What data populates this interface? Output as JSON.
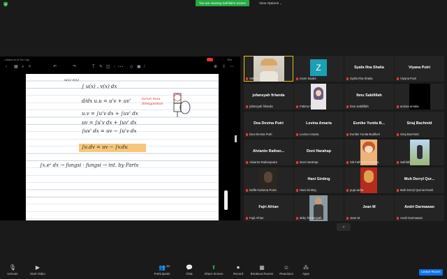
{
  "top": {
    "viewing_text": "You are viewing Safrilah's screen",
    "view_options": "View Options"
  },
  "ipad": {
    "status_left": "◂ Search 14.15 Thu 7 Apr",
    "status_right": "92%"
  },
  "note": {
    "lines": [
      "u(x) v(x)",
      "∫ u(x) . v(x) dx",
      "d/dx u.u = u'v + uv'",
      "u.v = ∫u'v dx + ∫uv' dx",
      "uv = ∫u'v dx + ∫uv' dx",
      "∫uv' dx = uv − ∫u'v dx",
      "∫u.dv = uv − ∫v.du",
      "∫x.eˣ dx  →  fungsi · fungsi  →  int. by Parts"
    ],
    "annotations": [
      "turun mau",
      "dinegasikan"
    ]
  },
  "participants": [
    {
      "big": "",
      "label": "Safrilah",
      "photo": "person",
      "active": true
    },
    {
      "big": "Z",
      "label": "zoom baa04",
      "photo": "avatar-z",
      "active": false
    },
    {
      "big": "Syafa Ifna Shalia",
      "label": "Syafa Ifna Shalia",
      "photo": "",
      "active": false
    },
    {
      "big": "Viyana Putri",
      "label": "Viyana Putri",
      "photo": "",
      "active": false
    },
    {
      "big": "jofansyah firlanda",
      "label": "jofansyah firlanda",
      "photo": "",
      "active": false
    },
    {
      "big": "",
      "label": "Fatima Nazril",
      "photo": "hijab",
      "active": false
    },
    {
      "big": "Ibnu Sabilillah",
      "label": "Ibnu Sabilillah",
      "photo": "",
      "active": false
    },
    {
      "big": "",
      "label": "annisa amalia",
      "photo": "black",
      "active": false
    },
    {
      "big": "Dea Devina Putri",
      "label": "Dea Devina Putri",
      "photo": "",
      "active": false
    },
    {
      "big": "Levina Amaria",
      "label": "Levina Amaria",
      "photo": "",
      "active": false
    },
    {
      "big": "Eunike Yunita B...",
      "label": "Eunike Yunita Budiheri",
      "photo": "",
      "active": false
    },
    {
      "big": "Siraj Bachmid",
      "label": "Siraj Bachmid",
      "photo": "",
      "active": false
    },
    {
      "big": "Alvianto Raihan...",
      "label": "Alvianto Raihanputra",
      "photo": "",
      "active": false
    },
    {
      "big": "Doni Harahap",
      "label": "Doni Harahap",
      "photo": "",
      "active": false
    },
    {
      "big": "",
      "label": "Siti Fathimah Nadhira",
      "photo": "anime",
      "active": false
    },
    {
      "big": "",
      "label": "Safrilah",
      "photo": "outdoor",
      "active": false
    },
    {
      "big": "",
      "label": "Daffa Karisma Putra",
      "photo": "dark",
      "active": false
    },
    {
      "big": "Hani Ginting",
      "label": "Hani Ginting",
      "photo": "",
      "active": false
    },
    {
      "big": "",
      "label": "puja widia",
      "photo": "red",
      "active": false
    },
    {
      "big": "Muh Derryl Qur...",
      "label": "Muh Derryl Qurnia Ramli",
      "photo": "",
      "active": false
    },
    {
      "big": "Fajri Afrian",
      "label": "Fajri Afrian",
      "photo": "",
      "active": false
    },
    {
      "big": "",
      "label": "abby firmansyah",
      "photo": "man",
      "active": false
    },
    {
      "big": "Jean M",
      "label": "Jean M",
      "photo": "",
      "active": false
    },
    {
      "big": "Andri Darmawan",
      "label": "Andri Darmawan",
      "photo": "",
      "active": false
    }
  ],
  "controls": {
    "unmute": "Unmute",
    "start_video": "Start Video",
    "participants": "Participants",
    "participants_count": "32",
    "chat": "Chat",
    "share_screen": "Share Screen",
    "record": "Record",
    "breakout": "Breakout Rooms",
    "reactions": "Reactions",
    "apps": "Apps",
    "leave": "Leave Room"
  },
  "colors": {
    "share_green": "#27a844",
    "leave_blue": "#0e72ed",
    "active_outline": "#e6c422",
    "highlight": "#f6c77b",
    "pen_red": "#d8322a"
  }
}
